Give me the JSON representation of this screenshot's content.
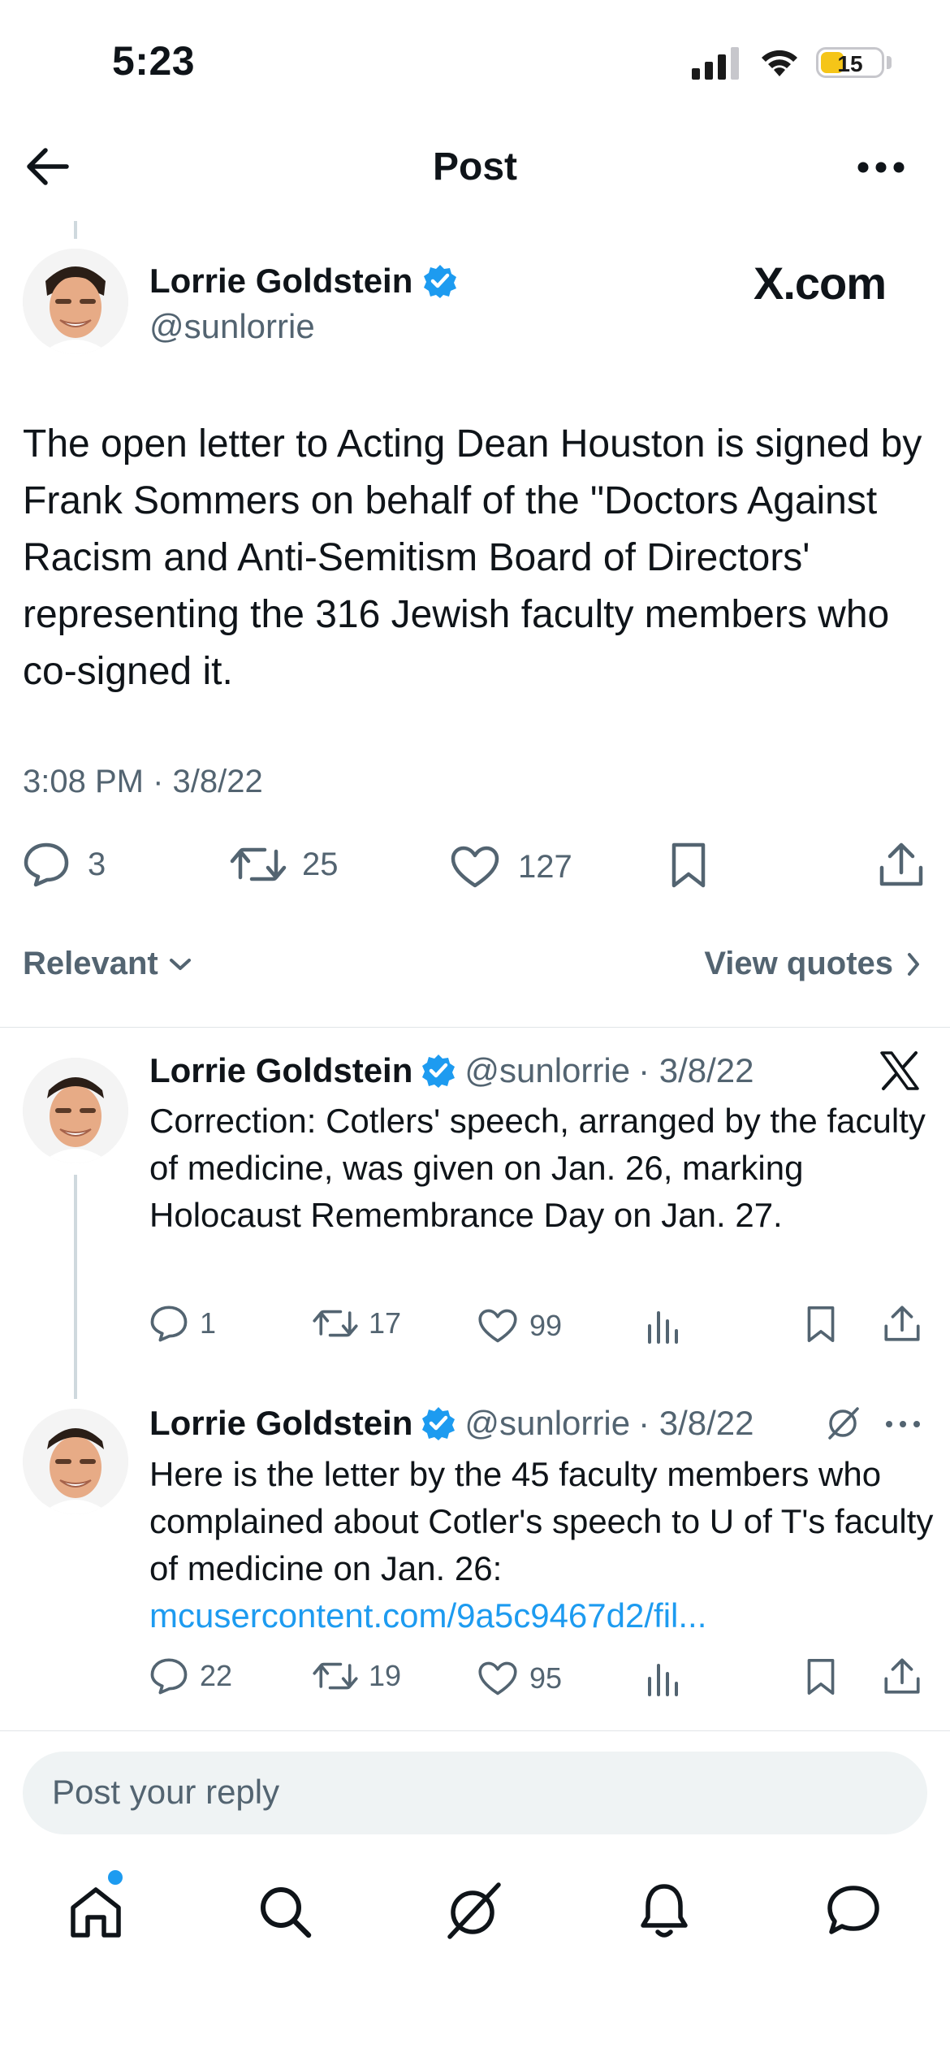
{
  "status_bar": {
    "time": "5:23",
    "battery": "15",
    "battery_level": 0.15
  },
  "header": {
    "title": "Post"
  },
  "tweet": {
    "name": "Lorrie Goldstein",
    "handle": "@sunlorrie",
    "source_logo": "X.com",
    "text": "The open letter to Acting Dean Houston is signed by Frank Sommers on behalf of the \"Doctors Against Racism and Anti-Semitism Board of Directors' representing the 316 Jewish faculty members who co-signed it.",
    "timestamp": "3:08 PM · 3/8/22",
    "replies": "3",
    "reposts": "25",
    "likes": "127"
  },
  "sort": {
    "label": "Relevant",
    "view_quotes": "View quotes"
  },
  "replies": [
    {
      "name": "Lorrie Goldstein",
      "handle": "@sunlorrie",
      "date": "· 3/8/22",
      "text": "Correction: Cotlers' speech, arranged by the faculty of medicine, was given on Jan. 26, marking Holocaust Remembrance Day on Jan. 27.",
      "link": "",
      "replies": "1",
      "reposts": "17",
      "likes": "99"
    },
    {
      "name": "Lorrie Goldstein",
      "handle": "@sunlorrie",
      "date": "· 3/8/22",
      "text": "Here is the letter by the 45 faculty members who complained about Cotler's speech to U of T's faculty of medicine on Jan. 26:",
      "link": "mcusercontent.com/9a5c9467d2/fil...",
      "replies": "22",
      "reposts": "19",
      "likes": "95"
    }
  ],
  "reply_box": {
    "placeholder": "Post your reply"
  },
  "colors": {
    "accent": "#1d9bf0",
    "verified": "#1d9bf0",
    "muted": "#536471",
    "battery": "#f5c518"
  },
  "icons": [
    "back-arrow-icon",
    "more-icon",
    "verified-icon",
    "reply-icon",
    "repost-icon",
    "like-icon",
    "bookmark-icon",
    "share-icon",
    "views-icon",
    "x-logo-icon",
    "grok-icon",
    "home-icon",
    "search-icon",
    "bell-icon",
    "messages-icon"
  ]
}
